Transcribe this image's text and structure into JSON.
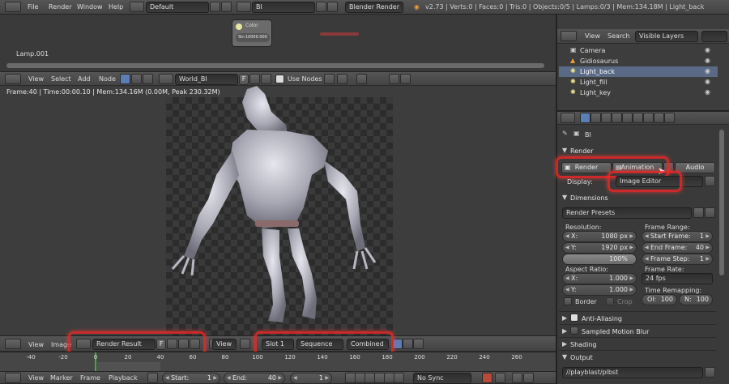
{
  "topbar": {
    "menus": [
      "File",
      "Render",
      "Window",
      "Help"
    ],
    "layout": "Default",
    "scene": "BI",
    "engine": "Blender Render",
    "stats": "v2.73 | Verts:0 | Faces:0 | Tris:0 | Objects:0/5 | Lamps:0/3 | Mem:134.18M | Light_back"
  },
  "node_editor": {
    "lamp_label": "Lamp.001",
    "node_line1": "Color",
    "node_line2": "Str:10000.000",
    "menus": [
      "View",
      "Select",
      "Add",
      "Node"
    ],
    "world": "World_BI",
    "world_f": "F",
    "use_nodes": "Use Nodes"
  },
  "image_editor": {
    "info": "Frame:40 | Time:00:00.10 | Mem:134.16M (0.00M, Peak 230.32M)",
    "menus": [
      "View",
      "Image"
    ],
    "image_name": "Render Result",
    "image_f": "F",
    "view_menu": "View",
    "slot": "Slot 1",
    "layer": "Sequence",
    "pass": "Combined"
  },
  "timeline": {
    "ticks": [
      "-40",
      "-20",
      "0",
      "20",
      "40",
      "60",
      "80",
      "100",
      "120",
      "140",
      "160",
      "180",
      "200",
      "220",
      "240",
      "260"
    ],
    "menus": [
      "View",
      "Marker",
      "Frame",
      "Playback"
    ],
    "start_label": "Start:",
    "start_value": "1",
    "end_label": "End:",
    "end_value": "40",
    "current": "1",
    "sync": "No Sync"
  },
  "outliner": {
    "menus": [
      "View",
      "Search"
    ],
    "filter": "Visible Layers",
    "items": [
      "Camera",
      "Gidiosaurus",
      "Light_back",
      "Light_fill",
      "Light_key"
    ]
  },
  "properties": {
    "scene_name": "BI",
    "render_section": "Render",
    "render_btn": "Render",
    "animation_btn": "Animation",
    "audio_btn": "Audio",
    "display_label": "Display:",
    "display_value": "Image Editor",
    "dimensions_section": "Dimensions",
    "presets": "Render Presets",
    "resolution_label": "Resolution:",
    "res_x_label": "X:",
    "res_x": "1080 px",
    "res_y_label": "Y:",
    "res_y": "1920 px",
    "res_pct": "100%",
    "frame_range_label": "Frame Range:",
    "start_frame_label": "Start Frame:",
    "start_frame": "1",
    "end_frame_label": "End Frame:",
    "end_frame": "40",
    "frame_step_label": "Frame Step:",
    "frame_step": "1",
    "aspect_label": "Aspect Ratio:",
    "aspect_x_label": "X:",
    "aspect_x": "1.000",
    "aspect_y_label": "Y:",
    "aspect_y": "1.000",
    "frame_rate_label": "Frame Rate:",
    "frame_rate": "24 fps",
    "time_remap_label": "Time Remapping:",
    "old_label": "Ol:",
    "old_value": "100",
    "new_label": "N:",
    "new_value": "100",
    "border_label": "Border",
    "crop_label": "Crop",
    "anti_aliasing": "Anti-Aliasing",
    "motion_blur": "Sampled Motion Blur",
    "shading": "Shading",
    "output": "Output",
    "output_path": "//playblast/plbst"
  }
}
